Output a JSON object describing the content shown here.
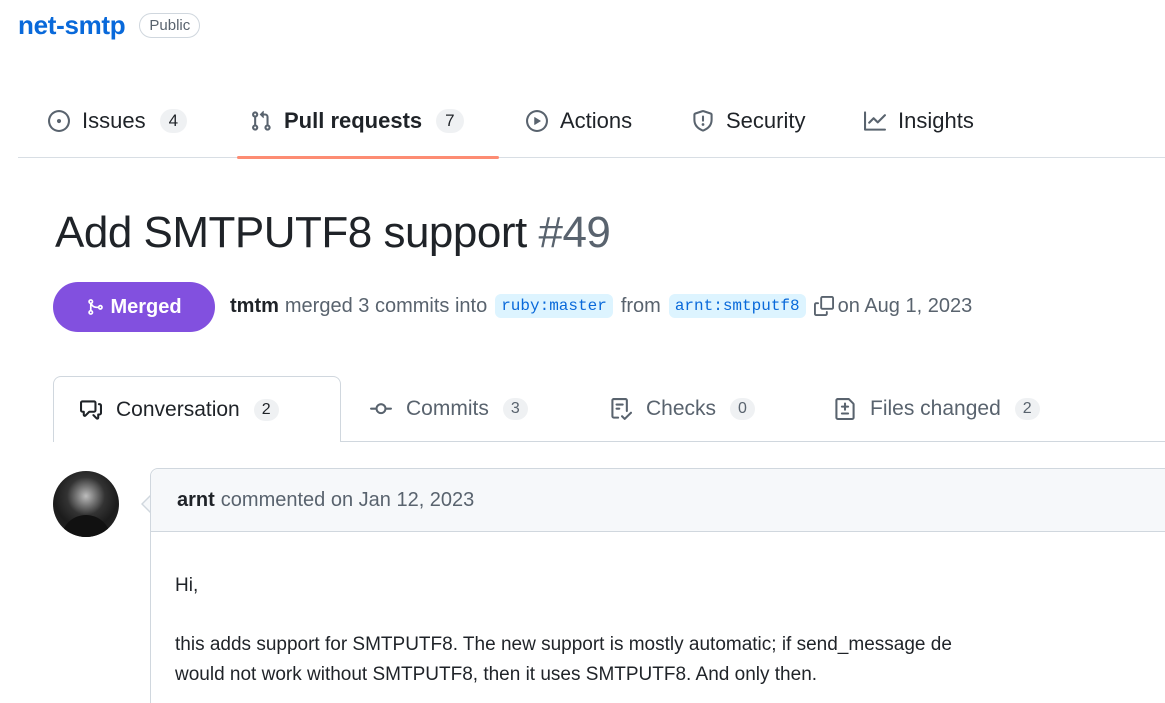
{
  "repo": {
    "name": "net-smtp",
    "visibility": "Public"
  },
  "nav": {
    "items": [
      {
        "label": "Issues",
        "count": "4",
        "icon": "issue-opened-icon"
      },
      {
        "label": "Pull requests",
        "count": "7",
        "icon": "git-pull-request-icon",
        "active": true
      },
      {
        "label": "Actions",
        "icon": "play-icon"
      },
      {
        "label": "Security",
        "icon": "shield-icon"
      },
      {
        "label": "Insights",
        "icon": "graph-icon"
      }
    ]
  },
  "pr": {
    "title": "Add SMTPUTF8 support",
    "number": "#49",
    "state": "Merged",
    "state_color": "#8250df",
    "author": "tmtm",
    "merged_text": "merged 3 commits into",
    "base_branch": "ruby:master",
    "from_text": "from",
    "head_branch": "arnt:smtputf8",
    "date_text": "on Aug 1, 2023"
  },
  "tabs": [
    {
      "label": "Conversation",
      "count": "2",
      "icon": "comment-discussion-icon",
      "active": true
    },
    {
      "label": "Commits",
      "count": "3",
      "icon": "git-commit-icon"
    },
    {
      "label": "Checks",
      "count": "0",
      "icon": "checklist-icon"
    },
    {
      "label": "Files changed",
      "count": "2",
      "icon": "file-diff-icon"
    }
  ],
  "comment": {
    "author": "arnt",
    "meta": "commented on Jan 12, 2023",
    "greeting": "Hi,",
    "line1": "this adds support for SMTPUTF8. The new support is mostly automatic; if send_message de",
    "line2": "would not work without SMTPUTF8, then it uses SMTPUTF8. And only then."
  },
  "colors": {
    "link": "#0969da",
    "nav_underline": "#fd8c73",
    "merged": "#8250df"
  }
}
